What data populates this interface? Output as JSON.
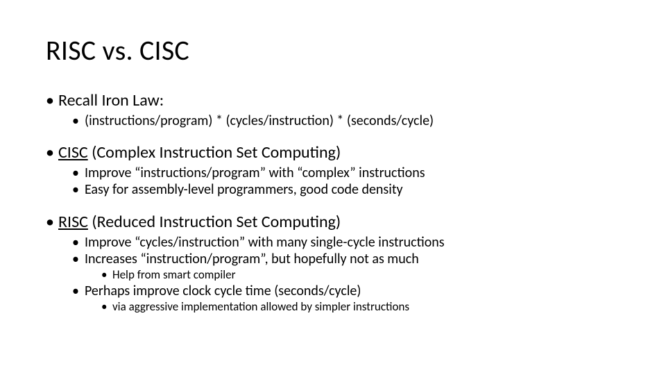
{
  "slide": {
    "title": "RISC vs. CISC",
    "bullets": [
      {
        "head_plain": "Recall Iron Law:",
        "sub": [
          {
            "text": "(instructions/program) * (cycles/instruction) * (seconds/cycle)"
          }
        ]
      },
      {
        "head_underlined": "CISC",
        "head_rest": " (Complex Instruction Set Computing)",
        "sub": [
          {
            "text": "Improve “instructions/program” with “complex” instructions"
          },
          {
            "text": "Easy for assembly-level programmers, good code density"
          }
        ]
      },
      {
        "head_underlined": "RISC",
        "head_rest": " (Reduced Instruction Set Computing)",
        "sub": [
          {
            "text": "Improve “cycles/instruction” with many single-cycle instructions"
          },
          {
            "text": "Increases “instruction/program”, but hopefully not as much",
            "subsub": [
              {
                "text": "Help from smart compiler"
              }
            ]
          },
          {
            "text": "Perhaps improve clock cycle time (seconds/cycle)",
            "subsub": [
              {
                "text": "via aggressive implementation allowed by simpler instructions"
              }
            ]
          }
        ]
      }
    ]
  }
}
